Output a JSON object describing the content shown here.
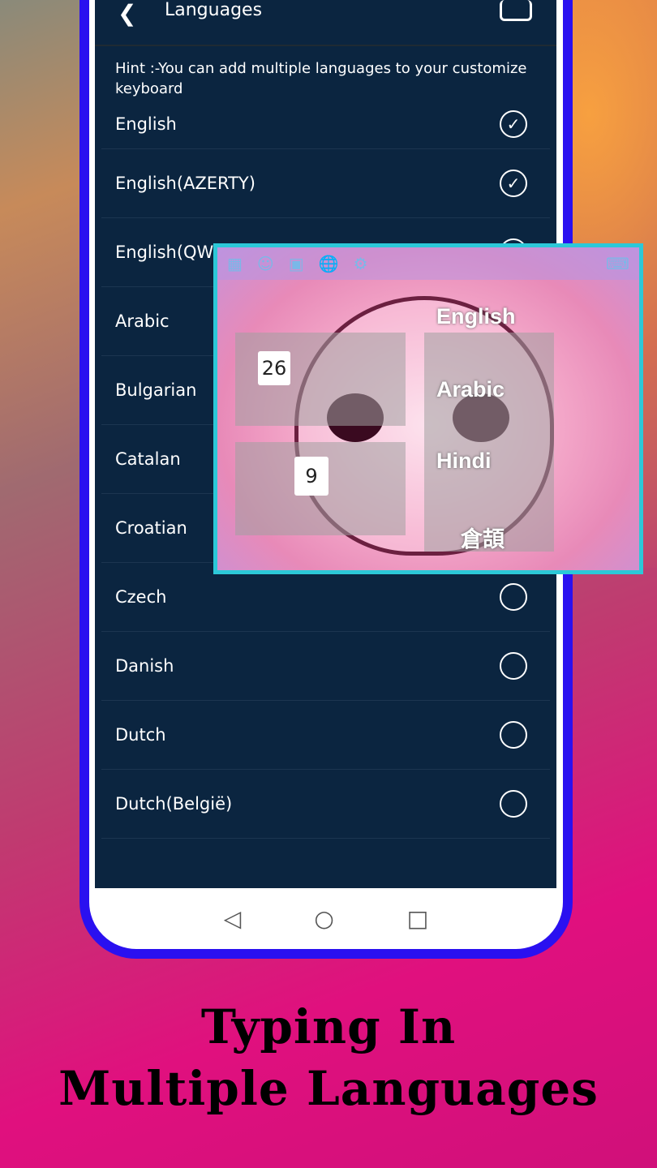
{
  "appbar": {
    "title": "Languages",
    "back_icon": "back-arrow-icon",
    "menu_icon": "keyboard-icon"
  },
  "hint": "Hint :-You can add multiple languages to your customize keyboard",
  "languages": [
    {
      "label": "English",
      "checked": true
    },
    {
      "label": "English(AZERTY)",
      "checked": true
    },
    {
      "label": "English(QWERTZ)",
      "checked": false
    },
    {
      "label": "Arabic",
      "checked": false
    },
    {
      "label": "Bulgarian",
      "checked": false
    },
    {
      "label": "Catalan",
      "checked": false
    },
    {
      "label": "Croatian",
      "checked": false
    },
    {
      "label": "Czech",
      "checked": false
    },
    {
      "label": "Danish",
      "checked": false
    },
    {
      "label": "Dutch",
      "checked": false
    },
    {
      "label": "Dutch(België)",
      "checked": false
    }
  ],
  "keyboard_preview": {
    "layout_counts": [
      "26",
      "9"
    ],
    "languages": [
      "English",
      "Arabic",
      "Hindi",
      "倉頡"
    ]
  },
  "caption": {
    "line1": "Typing In",
    "line2": "Multiple Languages"
  },
  "colors": {
    "frame": "#2a10f0",
    "screen": "#0b2540",
    "accent_border": "#2cc8d8"
  }
}
